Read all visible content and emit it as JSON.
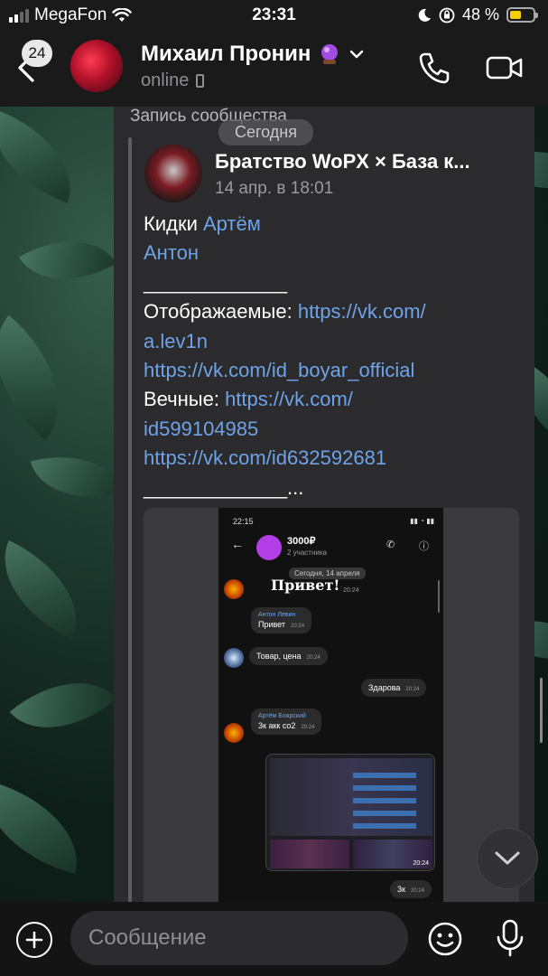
{
  "status_bar": {
    "carrier": "MegaFon",
    "time": "23:31",
    "battery": "48 %",
    "battery_level": 0.48
  },
  "header": {
    "unread_count": "24",
    "contact_name": "Михаил Пронин",
    "status": "online",
    "icons": [
      "back-chevron-icon",
      "crystal-ball-emoji",
      "chevron-down-icon",
      "phone-icon",
      "video-camera-icon"
    ]
  },
  "message": {
    "label": "Запись сообщества",
    "date_pill": "Сегодня",
    "community_name": "Братство WoPX × База к...",
    "community_date": "14 апр. в 18:01",
    "lines": [
      {
        "parts": [
          {
            "t": "Кидки "
          },
          {
            "t": "Артём",
            "link": true
          }
        ]
      },
      {
        "parts": [
          {
            "t": "Антон",
            "link": true
          }
        ]
      },
      {
        "parts": [
          {
            "t": "_____________"
          }
        ]
      },
      {
        "parts": [
          {
            "t": "Отображаемые: "
          },
          {
            "t": "https://vk.com/",
            "link": true
          }
        ]
      },
      {
        "parts": [
          {
            "t": "a.lev1n",
            "link": true
          }
        ]
      },
      {
        "parts": [
          {
            "t": "https://vk.com/id_boyar_official",
            "link": true
          }
        ]
      },
      {
        "parts": [
          {
            "t": "Вечные: "
          },
          {
            "t": "https://vk.com/",
            "link": true
          }
        ]
      },
      {
        "parts": [
          {
            "t": "id599104985",
            "link": true
          }
        ]
      },
      {
        "parts": [
          {
            "t": "https://vk.com/id632592681",
            "link": true
          }
        ]
      },
      {
        "parts": [
          {
            "t": "_____________..."
          }
        ]
      }
    ]
  },
  "embedded_screenshot": {
    "time": "22:15",
    "chat_title": "3000₽",
    "members": "2 участника",
    "date_pill": "Сегодня, 14 апреля",
    "sticker_text": "Привет!",
    "sticker_time": "20:24",
    "messages": [
      {
        "author": "Антон Левин",
        "text": "Привет",
        "time": "20:24"
      },
      {
        "author": "",
        "text": "Товар, цена",
        "time": "20:24"
      },
      {
        "author": "",
        "text": "Здарова",
        "time": "20:24"
      },
      {
        "author": "Артём Боярский",
        "text": "3к акк со2",
        "time": "20:24"
      },
      {
        "author": "",
        "text": "3к",
        "time": "20:24"
      }
    ],
    "photo_time": "20:24"
  },
  "input_bar": {
    "placeholder": "Сообщение",
    "icons": [
      "plus-icon",
      "emoji-icon",
      "microphone-icon"
    ]
  },
  "colors": {
    "link": "#6fa3e8",
    "bubble": "#2b2b2d",
    "battery": "#f5d000"
  }
}
